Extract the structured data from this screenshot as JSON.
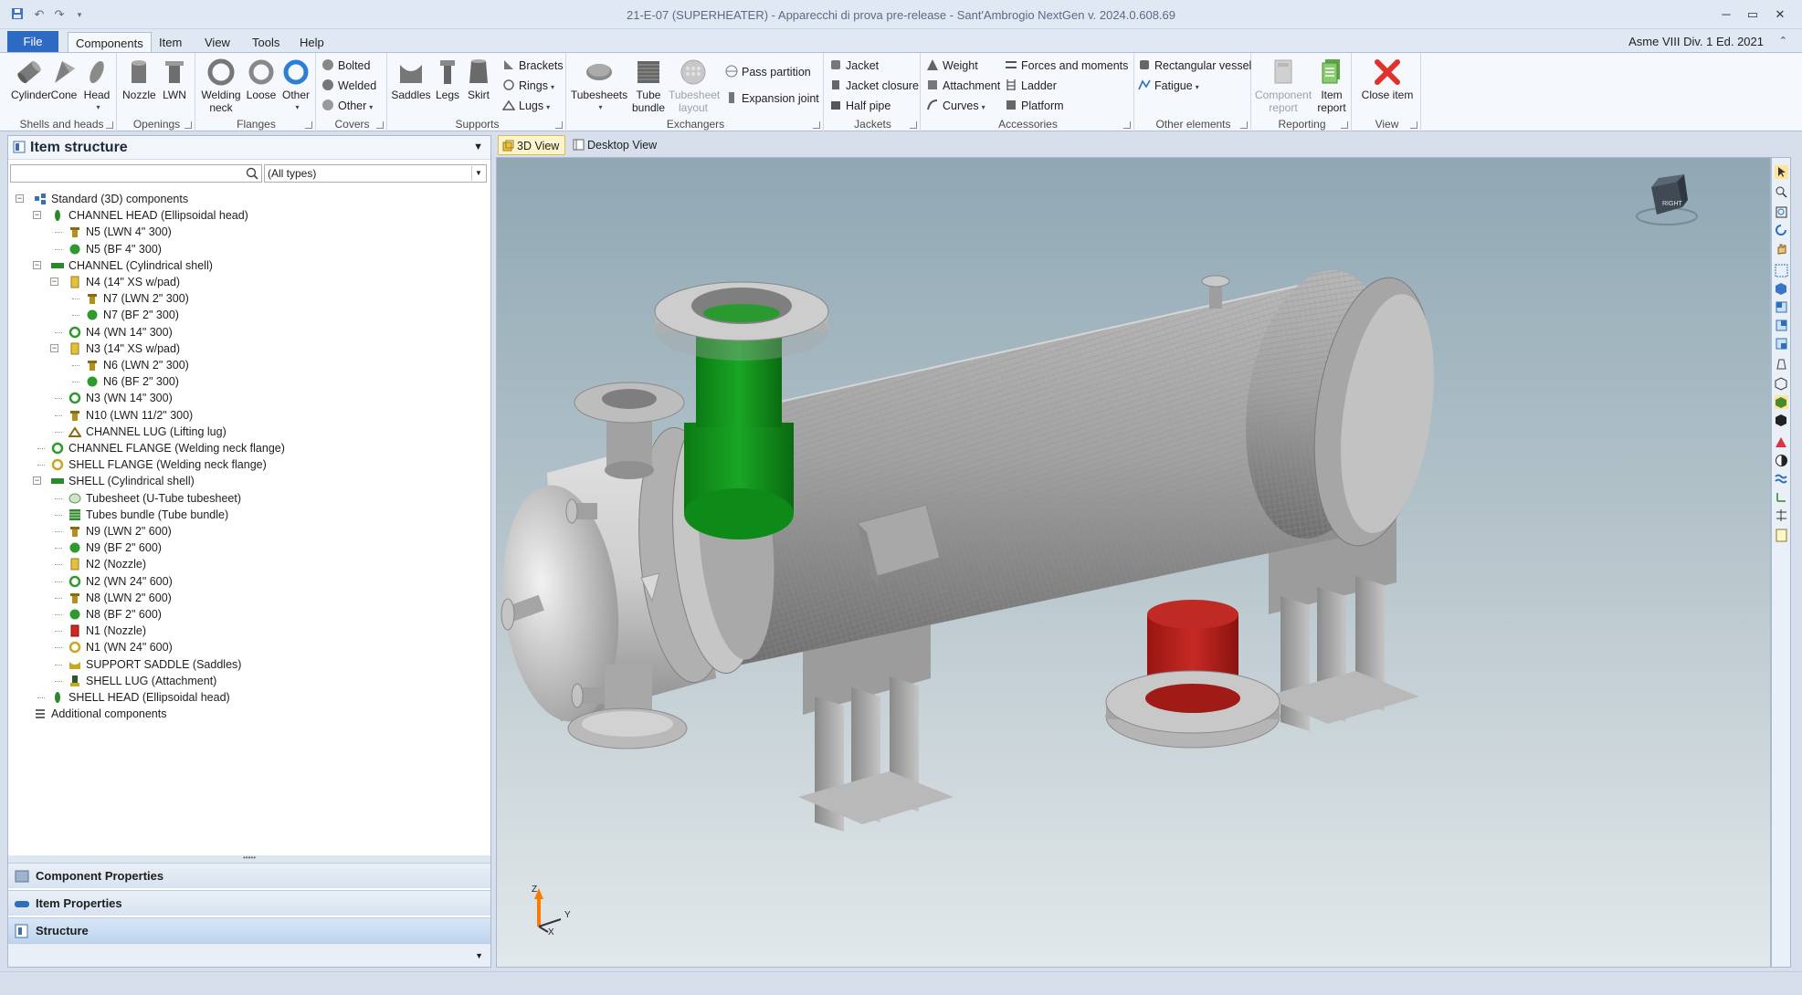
{
  "window": {
    "title": "21-E-07 (SUPERHEATER) - Apparecchi di prova pre-release - Sant'Ambrogio NextGen v. 2024.0.608.69",
    "standard": "Asme VIII Div. 1 Ed. 2021"
  },
  "menu": {
    "file": "File",
    "tabs": [
      "Components",
      "Item",
      "View",
      "Tools",
      "Help"
    ]
  },
  "ribbon": {
    "shells": {
      "label": "Shells and heads",
      "cylinder": "Cylinder",
      "cone": "Cone",
      "head": "Head"
    },
    "openings": {
      "label": "Openings",
      "nozzle": "Nozzle",
      "lwn": "LWN"
    },
    "flanges": {
      "label": "Flanges",
      "welding1": "Welding",
      "welding2": "neck",
      "loose": "Loose",
      "other": "Other"
    },
    "covers": {
      "label": "Covers",
      "bolted": "Bolted",
      "welded": "Welded",
      "other": "Other"
    },
    "supports": {
      "label": "Supports",
      "saddles": "Saddles",
      "legs": "Legs",
      "skirt": "Skirt",
      "brackets": "Brackets",
      "rings": "Rings",
      "lugs": "Lugs"
    },
    "exchangers": {
      "label": "Exchangers",
      "tubesheets": "Tubesheets",
      "tube1": "Tube",
      "tube2": "bundle",
      "tslayout1": "Tubesheet",
      "tslayout2": "layout",
      "pass": "Pass partition",
      "expansion": "Expansion joint"
    },
    "jackets": {
      "label": "Jackets",
      "jacket": "Jacket",
      "closure": "Jacket closure",
      "halfpipe": "Half pipe"
    },
    "accessories": {
      "label": "Accessories",
      "weight": "Weight",
      "attachment": "Attachment",
      "curves": "Curves",
      "forces": "Forces and moments",
      "ladder": "Ladder",
      "platform": "Platform"
    },
    "other": {
      "label": "Other elements",
      "rect": "Rectangular vessel",
      "fatigue": "Fatigue"
    },
    "reporting": {
      "label": "Reporting",
      "comp1": "Component",
      "comp2": "report",
      "item1": "Item",
      "item2": "report"
    },
    "view": {
      "label": "View",
      "close": "Close item"
    }
  },
  "panel": {
    "title": "Item structure",
    "search_placeholder": "",
    "type_filter": "(All types)",
    "tree": [
      "Standard (3D) components",
      "CHANNEL HEAD (Ellipsoidal head)",
      "N5 (LWN 4\" 300)",
      "N5 (BF 4\" 300)",
      "CHANNEL (Cylindrical shell)",
      "N4 (14\" XS w/pad)",
      "N7 (LWN 2\" 300)",
      "N7 (BF 2\" 300)",
      "N4 (WN 14\" 300)",
      "N3 (14\" XS w/pad)",
      "N6 (LWN 2\" 300)",
      "N6 (BF 2\" 300)",
      "N3 (WN 14\" 300)",
      "N10 (LWN 11/2\" 300)",
      "CHANNEL LUG (Lifting lug)",
      "CHANNEL FLANGE (Welding neck flange)",
      "SHELL FLANGE (Welding neck flange)",
      "SHELL (Cylindrical shell)",
      "Tubesheet (U-Tube tubesheet)",
      "Tubes bundle (Tube bundle)",
      "N9 (LWN 2\" 600)",
      "N9 (BF 2\" 600)",
      "N2 (Nozzle)",
      "N2 (WN 24\" 600)",
      "N8 (LWN 2\" 600)",
      "N8 (BF 2\" 600)",
      "N1 (Nozzle)",
      "N1 (WN 24\" 600)",
      "SUPPORT SADDLE (Saddles)",
      "SHELL LUG (Attachment)",
      "SHELL HEAD (Ellipsoidal head)",
      "Additional components"
    ],
    "nav": [
      "Component Properties",
      "Item Properties",
      "Structure"
    ]
  },
  "viewport": {
    "tabs": [
      "3D View",
      "Desktop View"
    ],
    "cube_face": "RIGHT",
    "axes": {
      "z": "Z",
      "y": "Y",
      "x": "X"
    }
  }
}
